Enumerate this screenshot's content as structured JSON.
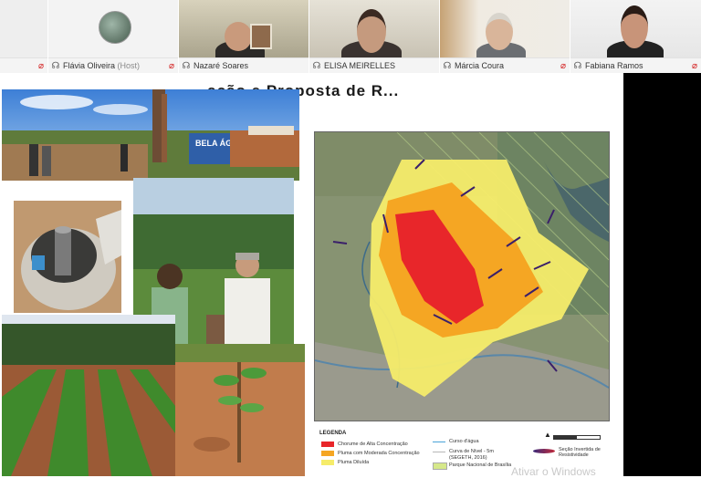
{
  "meeting": {
    "participants": [
      {
        "name": "",
        "host_suffix": "",
        "muted": true
      },
      {
        "name": "Flávia Oliveira",
        "host_suffix": "(Host)",
        "muted": true
      },
      {
        "name": "Nazaré Soares",
        "host_suffix": "",
        "muted": false
      },
      {
        "name": "ELISA MEIRELLES",
        "host_suffix": "",
        "muted": false,
        "active_speaker": true
      },
      {
        "name": "Márcia Coura",
        "host_suffix": "",
        "muted": true
      },
      {
        "name": "Fabiana Ramos",
        "host_suffix": "",
        "muted": true
      }
    ]
  },
  "slide": {
    "title": "...ação e Proposta de R...",
    "photos": {
      "top_sign": "BELA ÁGUA"
    },
    "map_legend": {
      "title": "LEGENDA",
      "items": [
        {
          "label": "Chorume de Alta Concentração",
          "color": "#e8262a"
        },
        {
          "label": "Pluma com Moderada Concentração",
          "color": "#f5a623"
        },
        {
          "label": "Pluma Diluída",
          "color": "#f6ec6a"
        },
        {
          "label": "Curso d'água",
          "color": "#4aa3d8"
        },
        {
          "label": "Curva de Nível - 5m",
          "color": "#b7b7b7"
        },
        {
          "label": "(SEGETH, 2016)",
          "color": ""
        },
        {
          "label": "Parque Nacional de Brasília",
          "color": "#d6e88a"
        },
        {
          "label": "Seção Invertida de Resistividade",
          "color": "#7a2a7a"
        }
      ]
    }
  },
  "watermark": "Ativar o Windows"
}
